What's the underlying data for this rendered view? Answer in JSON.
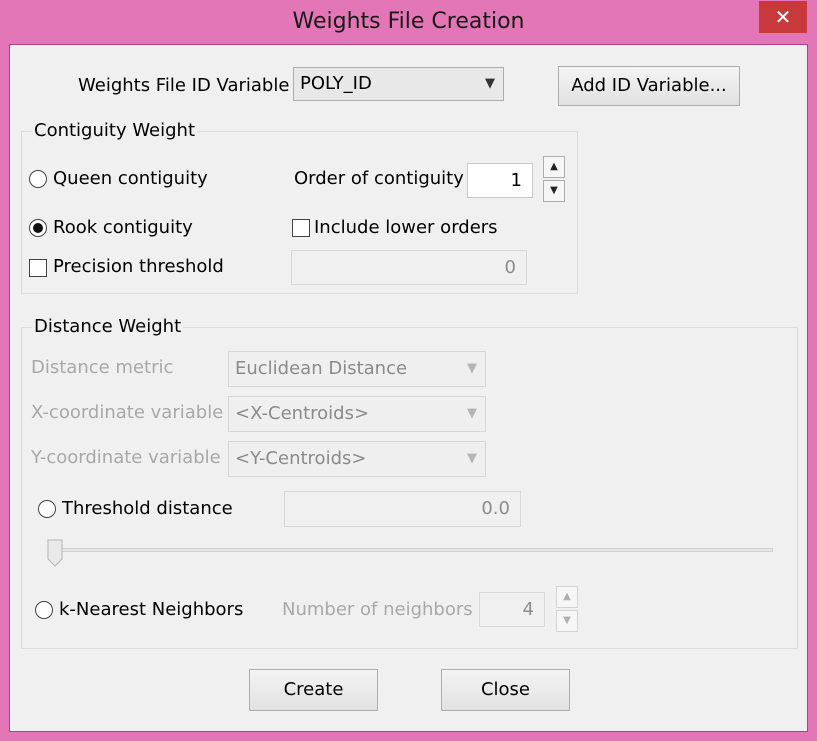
{
  "window": {
    "title": "Weights File Creation",
    "close_glyph": "✕"
  },
  "id_row": {
    "label": "Weights File ID Variable",
    "selected": "POLY_ID",
    "add_button": "Add ID Variable..."
  },
  "contiguity": {
    "title": "Contiguity Weight",
    "queen_label": "Queen contiguity",
    "order_label": "Order of contiguity",
    "order_value": "1",
    "rook_label": "Rook contiguity",
    "lower_orders_label": "Include lower orders",
    "precision_label": "Precision threshold",
    "precision_value": "0",
    "selected": "rook"
  },
  "distance": {
    "title": "Distance Weight",
    "metric_label": "Distance metric",
    "metric_value": "Euclidean Distance",
    "x_label": "X-coordinate variable",
    "x_value": "<X-Centroids>",
    "y_label": "Y-coordinate variable",
    "y_value": "<Y-Centroids>",
    "threshold_label": "Threshold distance",
    "threshold_value": "0.0",
    "slider_level": 0,
    "knn_label": "k-Nearest Neighbors",
    "neighbors_label": "Number of neighbors",
    "neighbors_value": "4"
  },
  "buttons": {
    "create": "Create",
    "close": "Close"
  },
  "icons": {
    "dropdown": "chevron-down-icon",
    "spin_up": "spin-up-icon",
    "spin_down": "spin-down-icon"
  },
  "colors": {
    "frame": "#e276b6",
    "close_button": "#c7393a",
    "client_bg": "#f0f0f0"
  }
}
